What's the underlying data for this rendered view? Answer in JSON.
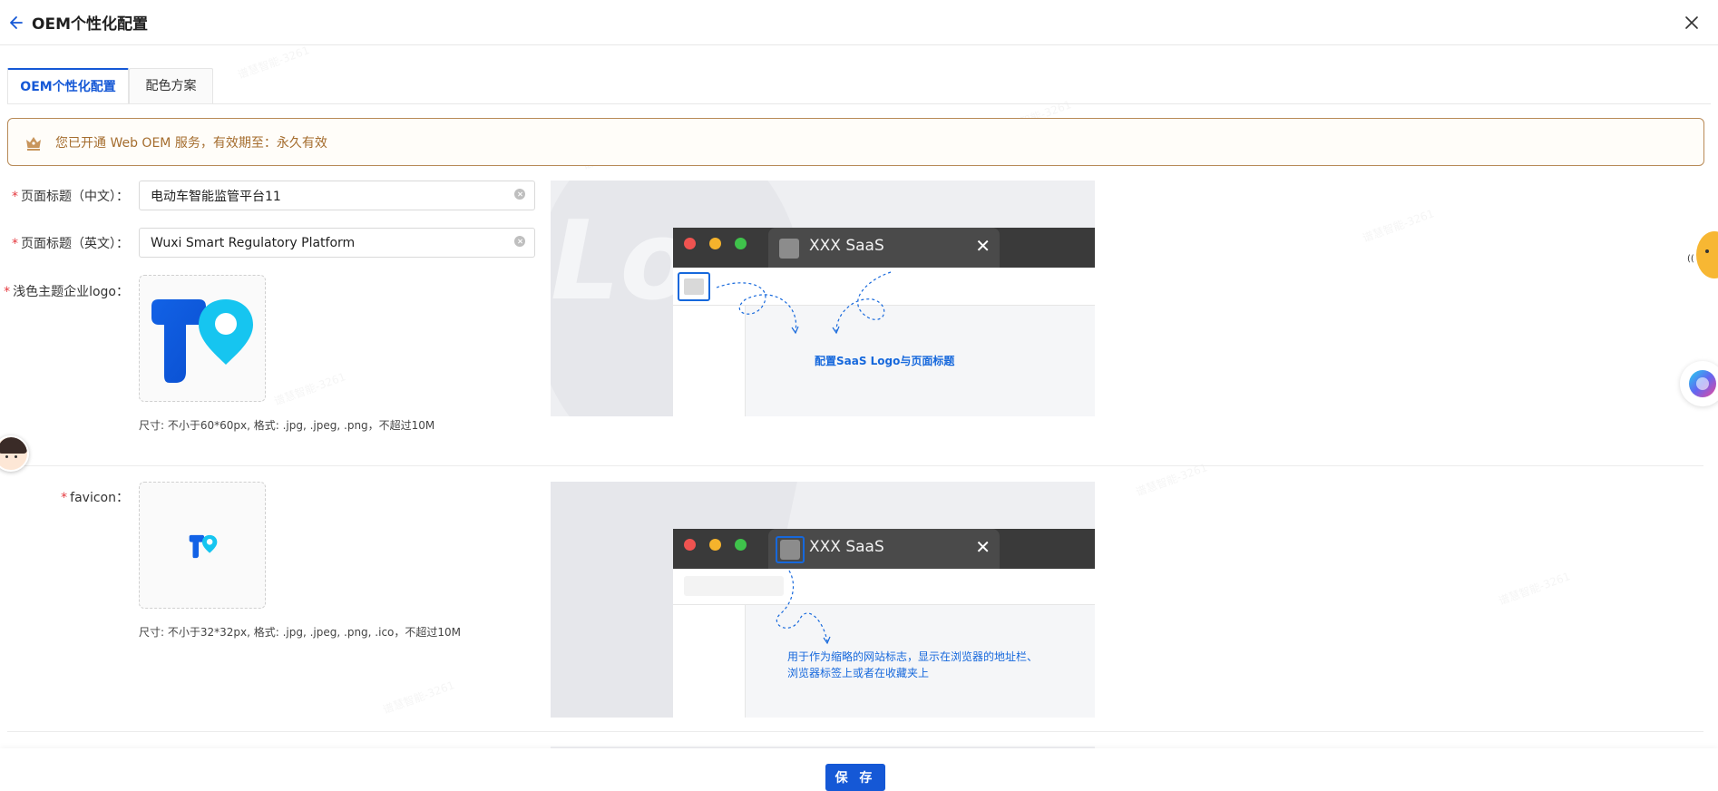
{
  "header": {
    "title": "OEM个性化配置"
  },
  "tabs": [
    {
      "label": "OEM个性化配置",
      "active": true
    },
    {
      "label": "配色方案",
      "active": false
    }
  ],
  "notice": {
    "text": "您已开通 Web OEM 服务，有效期至：永久有效"
  },
  "form": {
    "title_cn": {
      "required": "*",
      "label": "页面标题（中文）：",
      "value": "电动车智能监管平台11"
    },
    "title_en": {
      "required": "*",
      "label": "页面标题（英文）：",
      "value": "Wuxi Smart Regulatory Platform"
    },
    "logo": {
      "required": "*",
      "label": "浅色主题企业logo：",
      "hint": "尺寸: 不小于60*60px, 格式: .jpg, .jpeg, .png，不超过10M"
    },
    "favicon": {
      "required": "*",
      "label": "favicon：",
      "hint": "尺寸: 不小于32*32px, 格式: .jpg, .jpeg, .png, .ico，不超过10M"
    }
  },
  "preview_logo": {
    "tab_title": "XXX SaaS",
    "tab_close": "✕",
    "bg_text": "Lo",
    "callout": "配置SaaS Logo与页面标题"
  },
  "preview_favicon": {
    "tab_title": "XXX SaaS",
    "tab_close": "✕",
    "callout_line1": "用于作为缩略的网站标志，显示在浏览器的地址栏、",
    "callout_line2": "浏览器标签上或者在收藏夹上"
  },
  "footer": {
    "save_label": "保 存"
  },
  "colors": {
    "primary": "#1558d6",
    "notice_border": "#b88a57",
    "notice_text": "#a56d2e",
    "required": "#e5393f",
    "callout": "#1668dc"
  }
}
